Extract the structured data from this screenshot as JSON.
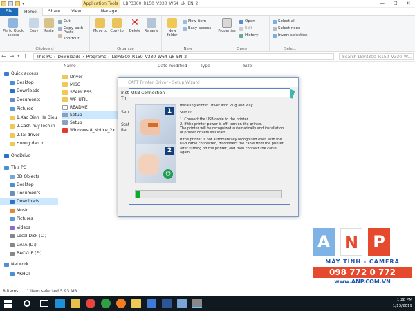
{
  "titlebar": {
    "context_tab": "Application Tools",
    "window_title": "LBP3300_R150_V330_W64_uk_EN_2",
    "controls": {
      "minimize": "—",
      "maximize": "☐",
      "close": "✕"
    }
  },
  "tabs": {
    "file": "File",
    "home": "Home",
    "share": "Share",
    "view": "View",
    "manage": "Manage"
  },
  "ribbon": {
    "clipboard": {
      "pin": "Pin to Quick access",
      "copy": "Copy",
      "paste": "Paste",
      "cut": "Cut",
      "copy_path": "Copy path",
      "paste_shortcut": "Paste shortcut",
      "label": "Clipboard"
    },
    "organize": {
      "move_to": "Move to",
      "copy_to": "Copy to",
      "delete": "Delete",
      "rename": "Rename",
      "label": "Organize"
    },
    "new": {
      "new_folder": "New folder",
      "new_item": "New item",
      "easy_access": "Easy access",
      "label": "New"
    },
    "open": {
      "properties": "Properties",
      "open": "Open",
      "edit": "Edit",
      "history": "History",
      "label": "Open"
    },
    "select": {
      "select_all": "Select all",
      "select_none": "Select none",
      "invert": "Invert selection",
      "label": "Select"
    }
  },
  "address": {
    "path": [
      "This PC",
      "Downloads",
      "Programs",
      "LBP3300_R150_V330_W64_uk_EN_2"
    ],
    "search_placeholder": "Search LBP3300_R150_V330_W..."
  },
  "navpane": {
    "items": [
      {
        "label": "Quick access"
      },
      {
        "label": "Desktop"
      },
      {
        "label": "Downloads"
      },
      {
        "label": "Documents"
      },
      {
        "label": "Pictures"
      },
      {
        "label": "1.Xac Dinh He Dieu"
      },
      {
        "label": "2.Cach huy lech in"
      },
      {
        "label": "2.Tai driver"
      },
      {
        "label": "Huong dan in"
      },
      {
        "label": "OneDrive"
      },
      {
        "label": "This PC"
      },
      {
        "label": "3D Objects"
      },
      {
        "label": "Desktop"
      },
      {
        "label": "Documents"
      },
      {
        "label": "Downloads"
      },
      {
        "label": "Music"
      },
      {
        "label": "Pictures"
      },
      {
        "label": "Videos"
      },
      {
        "label": "Local Disk (C:)"
      },
      {
        "label": "DATA (D:)"
      },
      {
        "label": "BACKUP (E:)"
      },
      {
        "label": "Network"
      },
      {
        "label": "AKHOI"
      }
    ]
  },
  "filelist": {
    "headers": {
      "name": "Name",
      "date": "Date modified",
      "type": "Type",
      "size": "Size"
    },
    "rows": [
      {
        "name": "Driver"
      },
      {
        "name": "MISC"
      },
      {
        "name": "SEAMLESS"
      },
      {
        "name": "WF_UTIL"
      },
      {
        "name": "README"
      },
      {
        "name": "Setup"
      },
      {
        "name": "Setup"
      },
      {
        "name": "Windows 8_Notice_2x"
      }
    ]
  },
  "statusbar": {
    "items": "8 items",
    "selected": "1 item selected  5.93 MB"
  },
  "wizard": {
    "title": "CAPT Printer Driver - Setup Wizard",
    "fragments": [
      "Inst",
      "Th",
      "Setu",
      "Stat",
      "Re"
    ]
  },
  "usb_dialog": {
    "title": "USB Connection",
    "heading": "Installing Printer Driver with Plug and Play.",
    "status_label": "Status:",
    "steps": "1. Connect the USB cable to the printer.\n2. If the printer power is off, turn on the printer.\nThe printer will be recognized automatically and installation of printer drivers will start.",
    "note": "If the printer is not automatically recognized even with the USB cable connected, disconnect the cable from the printer after turning off the printer, and then connect the cable again.",
    "panel1": "1",
    "panel2": "2",
    "progress": 0.03
  },
  "watermark": {
    "letters": [
      "A",
      "N",
      "P"
    ],
    "tagline": "MÁY TÍNH - CAMERA",
    "phone": "098 772 0 772",
    "website": "www.ANP.COM.VN"
  },
  "taskbar": {
    "search_placeholder": "",
    "time": "1:28 PM",
    "date": "1/13/2019"
  },
  "colors": {
    "file_tab": "#1e6bb8",
    "selection": "#cce8ff",
    "progress": "#06b025",
    "anp_a": "#7fb3e6",
    "anp_n": "#ffffff",
    "anp_p": "#e64a2e",
    "taskbar": "#101820"
  }
}
